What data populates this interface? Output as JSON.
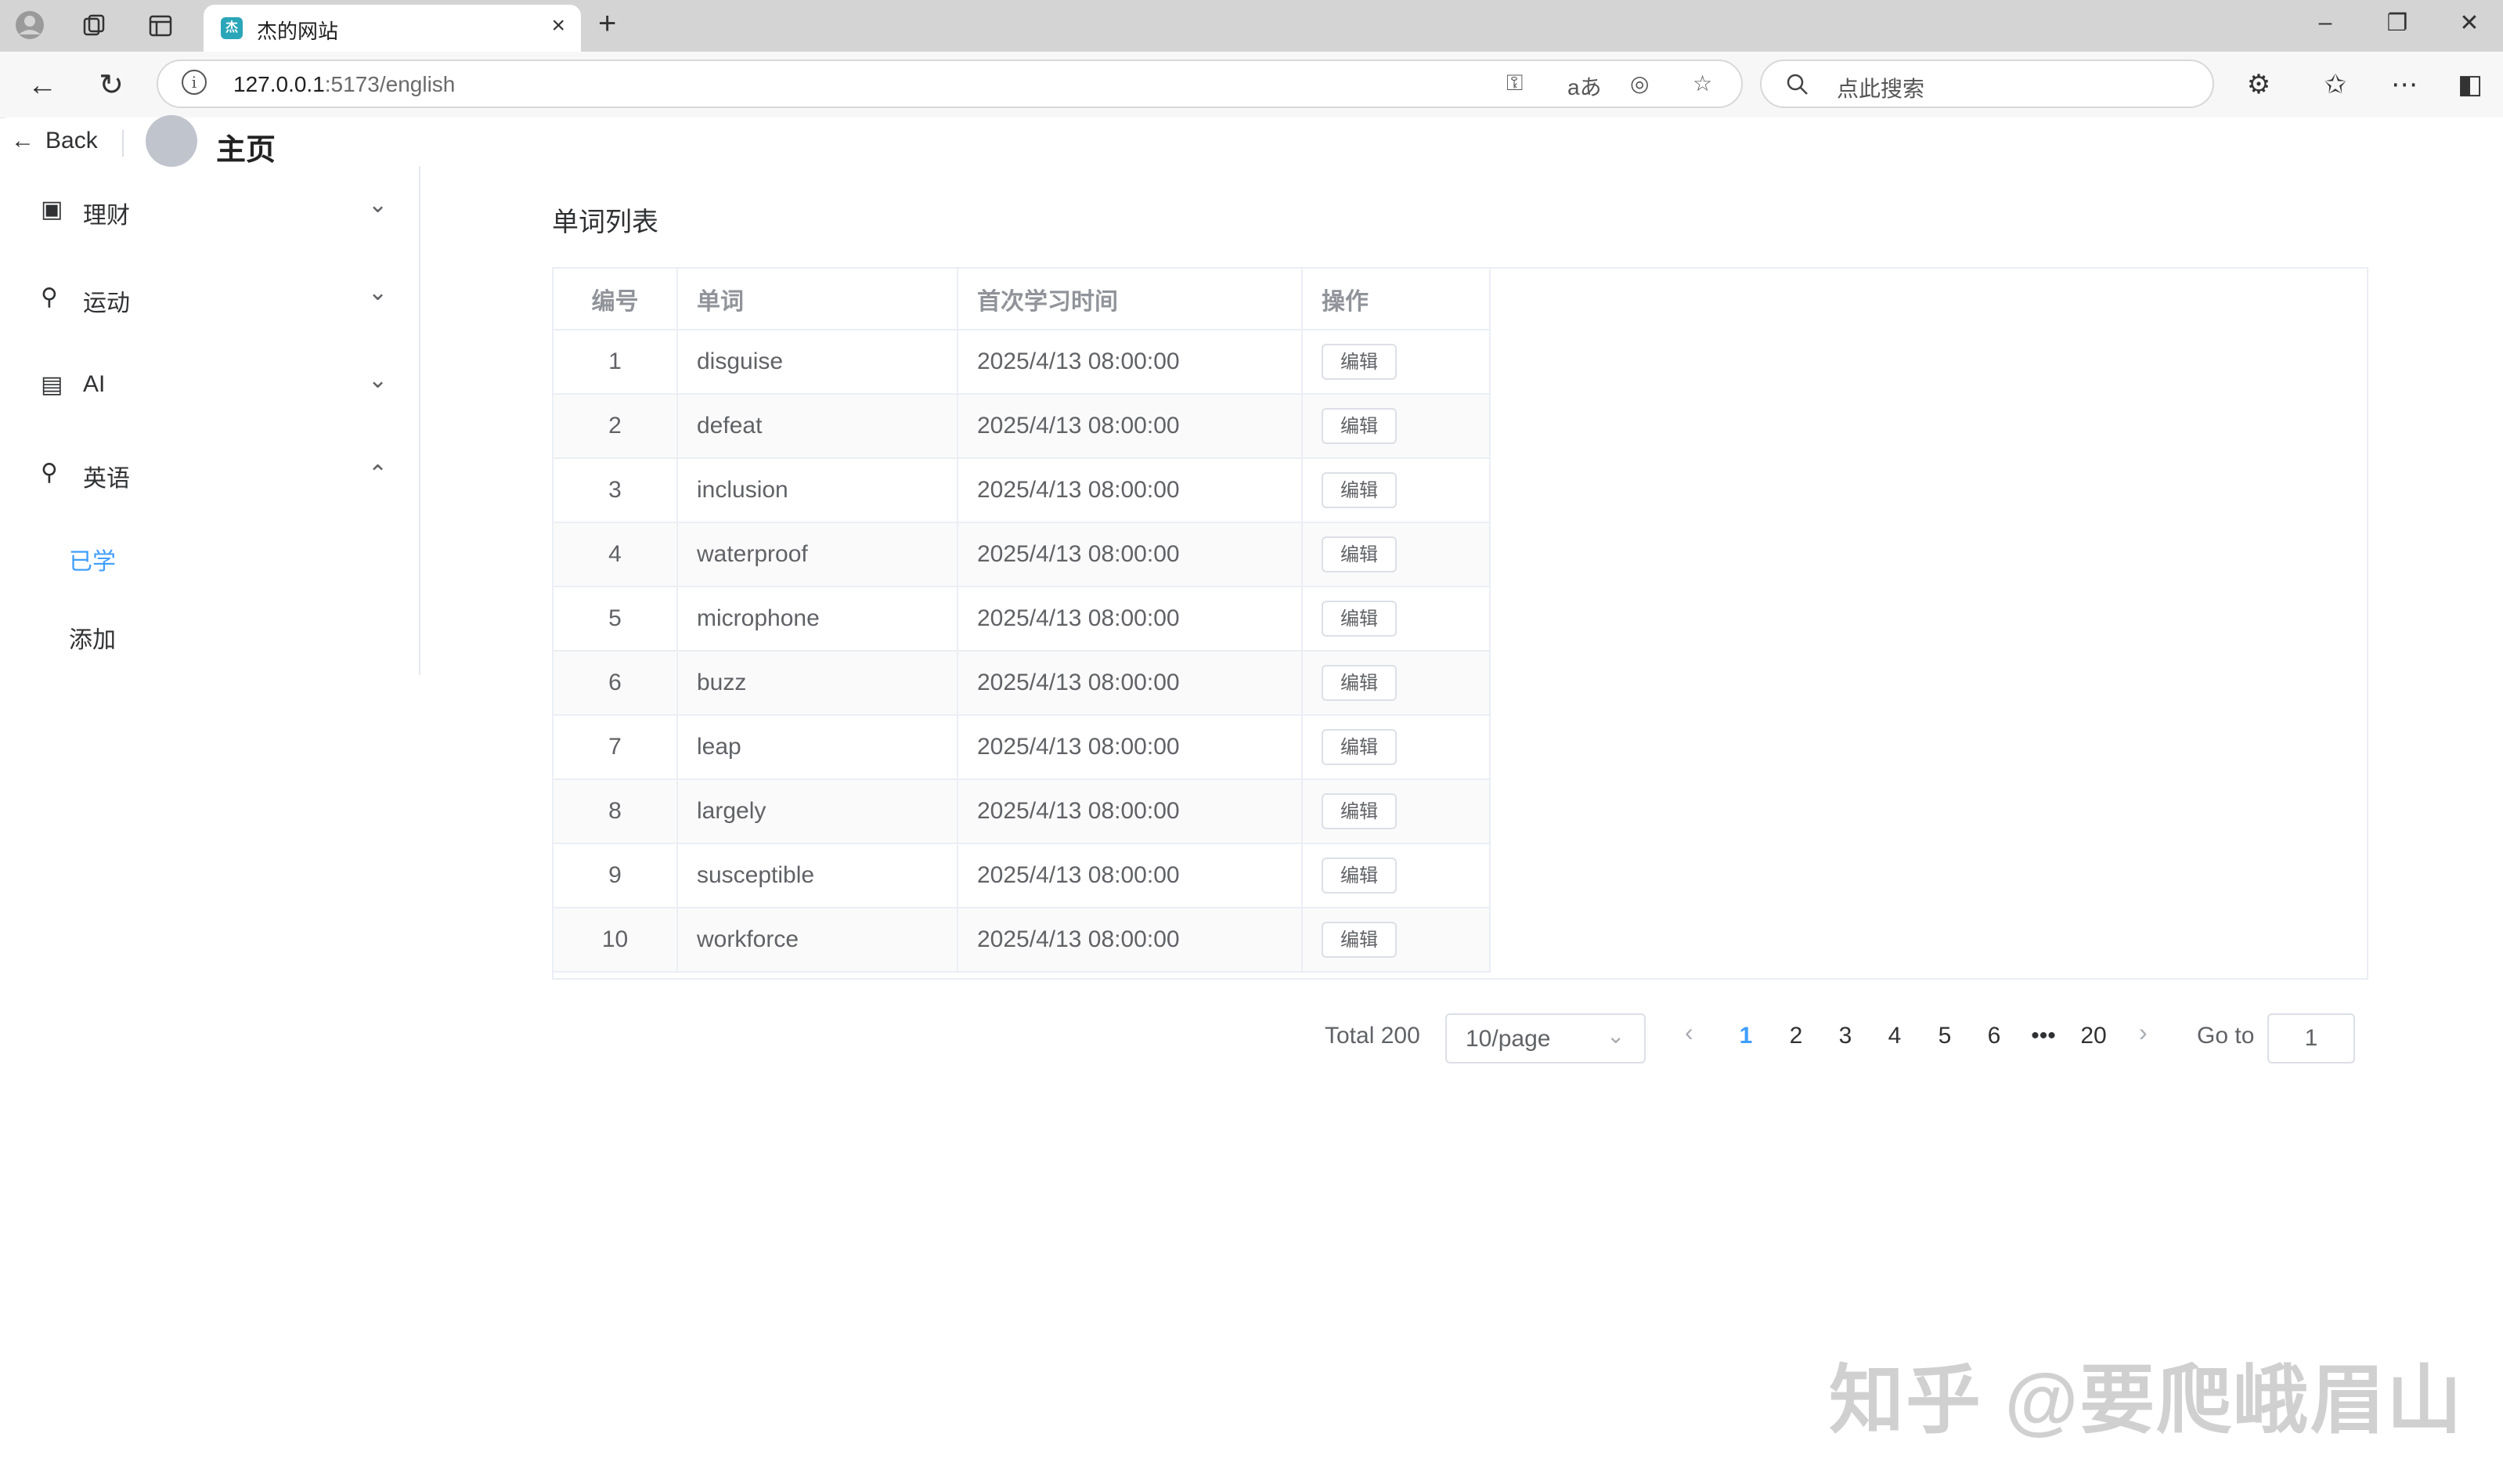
{
  "browser": {
    "tab_title": "杰的网站",
    "tab_close": "×",
    "new_tab": "+",
    "url_host": "127.0.0.1",
    "url_rest": ":5173/english",
    "search_placeholder": "点此搜索"
  },
  "header": {
    "back_label": "Back",
    "title": "主页"
  },
  "sidebar": {
    "items": [
      {
        "label": "理财",
        "icon": "wallet-icon",
        "expanded": false
      },
      {
        "label": "运动",
        "icon": "bike-icon",
        "expanded": false
      },
      {
        "label": "AI",
        "icon": "presentation-icon",
        "expanded": false
      },
      {
        "label": "英语",
        "icon": "bike-icon",
        "expanded": true
      }
    ],
    "sub_items": [
      {
        "label": "已学",
        "active": true
      },
      {
        "label": "添加",
        "active": false
      }
    ]
  },
  "main": {
    "section_title": "单词列表",
    "columns": [
      "编号",
      "单词",
      "首次学习时间",
      "操作"
    ],
    "edit_label": "编辑",
    "rows": [
      {
        "id": "1",
        "word": "disguise",
        "time": "2025/4/13 08:00:00"
      },
      {
        "id": "2",
        "word": "defeat",
        "time": "2025/4/13 08:00:00"
      },
      {
        "id": "3",
        "word": "inclusion",
        "time": "2025/4/13 08:00:00"
      },
      {
        "id": "4",
        "word": "waterproof",
        "time": "2025/4/13 08:00:00"
      },
      {
        "id": "5",
        "word": "microphone",
        "time": "2025/4/13 08:00:00"
      },
      {
        "id": "6",
        "word": "buzz",
        "time": "2025/4/13 08:00:00"
      },
      {
        "id": "7",
        "word": "leap",
        "time": "2025/4/13 08:00:00"
      },
      {
        "id": "8",
        "word": "largely",
        "time": "2025/4/13 08:00:00"
      },
      {
        "id": "9",
        "word": "susceptible",
        "time": "2025/4/13 08:00:00"
      },
      {
        "id": "10",
        "word": "workforce",
        "time": "2025/4/13 08:00:00"
      }
    ]
  },
  "pagination": {
    "total": "Total 200",
    "page_size": "10/page",
    "pages": [
      "1",
      "2",
      "3",
      "4",
      "5",
      "6",
      "•••",
      "20"
    ],
    "current": "1",
    "goto_label": "Go to",
    "goto_value": "1"
  },
  "watermark": "知乎 @要爬峨眉山",
  "colors": {
    "accent": "#409eff",
    "border": "#ebeef5",
    "header_text": "#909399"
  }
}
